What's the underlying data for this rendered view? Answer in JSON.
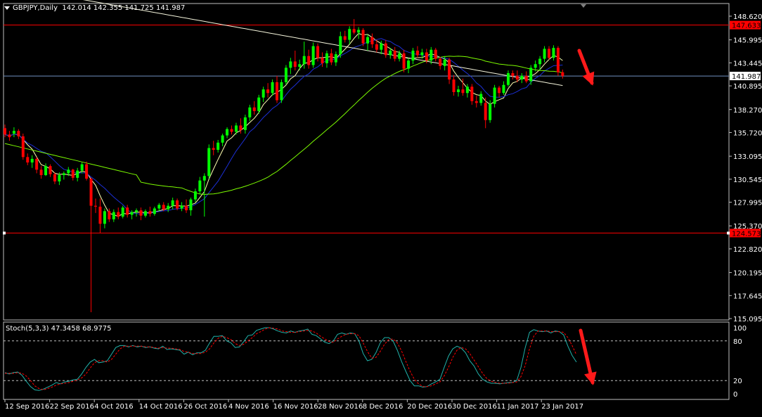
{
  "window": {
    "symbol_label": "GBPJPY,Daily",
    "ohlc_label": "142.014 142.355 141.725 141.987",
    "stoch_label": "Stoch(5,3,3) 47.3458 68.9775"
  },
  "colors": {
    "background": "#000000",
    "grid_border": "#c0c0c0",
    "bull_candle": "#00ff00",
    "bear_candle": "#ff0000",
    "ma_fast": "#ffffb0",
    "ma_mid": "#1c2fd6",
    "ma_slow": "#7cfc00",
    "ma_long": "#f5f5dc",
    "hline": "#ff0000",
    "bid_line": "#6f8fbf",
    "stoch_main": "#20b2aa",
    "stoch_signal": "#ff0000",
    "arrow": "#ff1a1a"
  },
  "chart_data": [
    {
      "type": "candlestick",
      "name": "price",
      "y_ticks": [
        "148.620",
        "145.995",
        "143.445",
        "140.895",
        "138.270",
        "135.720",
        "133.095",
        "130.545",
        "127.995",
        "125.370",
        "122.820",
        "120.195",
        "117.645",
        "115.095"
      ],
      "ylim": [
        115.095,
        148.62
      ],
      "x_ticks": [
        "12 Sep 2016",
        "22 Sep 2016",
        "4 Oct 2016",
        "14 Oct 2016",
        "26 Oct 2016",
        "4 Nov 2016",
        "16 Nov 2016",
        "28 Nov 2016",
        "8 Dec 2016",
        "20 Dec 2016",
        "30 Dec 2016",
        "11 Jan 2017",
        "23 Jan 2017"
      ],
      "price_tags": {
        "upper_level": "147.633",
        "bid": "141.987",
        "lower_level": "124.573"
      },
      "hlines": [
        147.633,
        124.573
      ],
      "bid": 141.987,
      "candles": [
        [
          136.2,
          136.6,
          135.2,
          135.5
        ],
        [
          135.5,
          135.9,
          134.8,
          135.2
        ],
        [
          135.6,
          136.3,
          135.2,
          135.9
        ],
        [
          135.9,
          136.1,
          135.0,
          135.3
        ],
        [
          135.3,
          135.6,
          132.7,
          133.0
        ],
        [
          133.0,
          133.4,
          132.1,
          132.4
        ],
        [
          132.4,
          133.2,
          131.8,
          132.8
        ],
        [
          132.8,
          133.0,
          131.2,
          131.6
        ],
        [
          131.6,
          132.0,
          130.6,
          131.0
        ],
        [
          131.0,
          132.3,
          130.9,
          132.0
        ],
        [
          132.0,
          132.2,
          130.8,
          131.1
        ],
        [
          131.1,
          131.3,
          130.0,
          130.3
        ],
        [
          130.3,
          131.3,
          129.9,
          131.0
        ],
        [
          131.0,
          131.4,
          130.5,
          131.2
        ],
        [
          131.2,
          131.9,
          130.9,
          131.6
        ],
        [
          131.6,
          131.7,
          130.4,
          130.7
        ],
        [
          130.7,
          131.8,
          130.3,
          131.5
        ],
        [
          131.5,
          132.4,
          131.2,
          132.2
        ],
        [
          132.2,
          132.5,
          130.4,
          130.6
        ],
        [
          130.6,
          130.7,
          115.8,
          127.6
        ],
        [
          127.6,
          128.4,
          126.8,
          127.5
        ],
        [
          127.5,
          128.4,
          124.6,
          125.6
        ],
        [
          125.6,
          127.3,
          125.1,
          127.0
        ],
        [
          127.0,
          127.3,
          125.8,
          126.1
        ],
        [
          126.1,
          127.2,
          125.8,
          126.9
        ],
        [
          126.9,
          127.4,
          126.1,
          126.4
        ],
        [
          126.4,
          127.6,
          126.2,
          127.4
        ],
        [
          127.4,
          127.7,
          126.3,
          126.6
        ],
        [
          126.6,
          127.1,
          126.1,
          126.9
        ],
        [
          126.9,
          127.3,
          126.4,
          127.1
        ],
        [
          127.1,
          127.4,
          126.0,
          126.5
        ],
        [
          126.5,
          127.2,
          126.3,
          127.0
        ],
        [
          127.0,
          127.5,
          126.4,
          126.7
        ],
        [
          126.7,
          127.5,
          126.5,
          127.3
        ],
        [
          127.3,
          127.9,
          127.0,
          127.7
        ],
        [
          127.7,
          128.0,
          127.0,
          127.2
        ],
        [
          127.2,
          127.9,
          126.9,
          127.6
        ],
        [
          127.6,
          128.5,
          127.2,
          128.2
        ],
        [
          128.2,
          128.4,
          127.1,
          127.3
        ],
        [
          127.3,
          128.0,
          127.0,
          127.6
        ],
        [
          127.6,
          128.3,
          126.8,
          127.1
        ],
        [
          127.1,
          128.5,
          126.5,
          128.3
        ],
        [
          128.3,
          129.5,
          128.0,
          129.2
        ],
        [
          129.2,
          130.8,
          128.9,
          130.4
        ],
        [
          130.4,
          131.2,
          126.4,
          130.9
        ],
        [
          130.9,
          134.4,
          130.6,
          134.0
        ],
        [
          134.0,
          134.8,
          133.2,
          133.8
        ],
        [
          133.8,
          134.9,
          133.5,
          134.6
        ],
        [
          134.6,
          135.6,
          134.2,
          135.4
        ],
        [
          135.4,
          136.3,
          135.1,
          136.1
        ],
        [
          136.1,
          136.5,
          135.5,
          135.8
        ],
        [
          135.8,
          136.8,
          135.5,
          136.5
        ],
        [
          136.5,
          137.3,
          135.6,
          136.0
        ],
        [
          136.0,
          137.7,
          135.6,
          137.4
        ],
        [
          137.4,
          138.8,
          137.0,
          138.5
        ],
        [
          138.5,
          139.2,
          137.7,
          138.1
        ],
        [
          138.1,
          139.9,
          137.8,
          139.6
        ],
        [
          139.6,
          140.8,
          139.1,
          140.5
        ],
        [
          140.5,
          141.2,
          139.6,
          140.1
        ],
        [
          140.1,
          141.6,
          139.8,
          141.3
        ],
        [
          141.3,
          142.0,
          139.0,
          139.3
        ],
        [
          139.3,
          141.6,
          139.0,
          141.3
        ],
        [
          141.3,
          143.2,
          141.0,
          142.9
        ],
        [
          142.9,
          144.0,
          142.2,
          143.6
        ],
        [
          143.6,
          144.8,
          142.6,
          143.0
        ],
        [
          143.0,
          143.8,
          142.6,
          143.3
        ],
        [
          143.3,
          145.8,
          142.8,
          144.2
        ],
        [
          144.2,
          144.9,
          142.8,
          143.2
        ],
        [
          143.2,
          145.7,
          142.9,
          145.3
        ],
        [
          145.3,
          145.6,
          143.6,
          144.0
        ],
        [
          144.0,
          144.6,
          143.0,
          143.4
        ],
        [
          143.4,
          144.8,
          142.9,
          144.5
        ],
        [
          144.5,
          145.0,
          143.2,
          143.5
        ],
        [
          143.5,
          144.7,
          143.1,
          144.4
        ],
        [
          144.4,
          146.9,
          144.0,
          146.4
        ],
        [
          146.4,
          147.0,
          145.7,
          146.0
        ],
        [
          146.0,
          147.5,
          145.5,
          147.2
        ],
        [
          147.2,
          148.3,
          146.6,
          146.8
        ],
        [
          146.8,
          147.4,
          146.1,
          147.1
        ],
        [
          147.1,
          147.3,
          145.3,
          145.6
        ],
        [
          145.6,
          146.6,
          144.8,
          146.3
        ],
        [
          146.3,
          146.7,
          145.1,
          145.5
        ],
        [
          145.5,
          146.0,
          144.6,
          144.9
        ],
        [
          144.9,
          145.9,
          144.4,
          145.6
        ],
        [
          145.6,
          146.0,
          144.0,
          144.3
        ],
        [
          144.3,
          145.1,
          143.9,
          144.8
        ],
        [
          144.8,
          145.2,
          143.6,
          143.9
        ],
        [
          143.9,
          144.8,
          143.6,
          144.5
        ],
        [
          144.5,
          144.9,
          142.4,
          142.8
        ],
        [
          142.8,
          144.0,
          142.3,
          143.7
        ],
        [
          143.7,
          145.1,
          143.3,
          144.8
        ],
        [
          144.8,
          145.3,
          144.0,
          144.3
        ],
        [
          144.3,
          145.0,
          143.9,
          144.6
        ],
        [
          144.6,
          145.0,
          143.4,
          143.7
        ],
        [
          143.7,
          145.2,
          143.3,
          144.9
        ],
        [
          144.9,
          145.1,
          143.6,
          143.9
        ],
        [
          143.9,
          144.1,
          142.7,
          143.1
        ],
        [
          143.1,
          144.2,
          142.6,
          143.8
        ],
        [
          143.8,
          144.0,
          141.1,
          141.6
        ],
        [
          141.6,
          142.1,
          139.8,
          140.2
        ],
        [
          140.2,
          140.9,
          139.7,
          140.5
        ],
        [
          140.5,
          141.7,
          139.8,
          140.1
        ],
        [
          140.1,
          141.1,
          139.6,
          140.8
        ],
        [
          140.8,
          141.1,
          138.8,
          139.2
        ],
        [
          139.2,
          139.8,
          138.5,
          139.0
        ],
        [
          139.0,
          140.3,
          138.7,
          140.0
        ],
        [
          139.0,
          139.6,
          136.2,
          137.1
        ],
        [
          137.1,
          139.3,
          136.8,
          138.9
        ],
        [
          138.9,
          141.0,
          138.5,
          140.7
        ],
        [
          140.7,
          140.9,
          139.6,
          140.1
        ],
        [
          140.1,
          141.4,
          139.9,
          141.0
        ],
        [
          141.0,
          142.6,
          140.8,
          142.3
        ],
        [
          142.3,
          142.6,
          141.6,
          142.0
        ],
        [
          142.0,
          142.6,
          141.3,
          141.6
        ],
        [
          141.6,
          142.3,
          141.2,
          142.0
        ],
        [
          142.0,
          142.5,
          141.2,
          141.4
        ],
        [
          141.4,
          143.2,
          141.0,
          142.9
        ],
        [
          142.9,
          143.7,
          142.5,
          143.3
        ],
        [
          143.3,
          144.2,
          142.6,
          143.9
        ],
        [
          143.9,
          145.3,
          143.5,
          145.0
        ],
        [
          145.0,
          145.3,
          143.8,
          144.0
        ],
        [
          144.0,
          145.4,
          143.7,
          145.1
        ],
        [
          145.1,
          145.3,
          142.0,
          142.4
        ],
        [
          142.4,
          142.7,
          141.7,
          142.0
        ]
      ]
    },
    {
      "type": "line",
      "name": "stochastic",
      "title": "Stoch(5,3,3) 47.3458 68.9775",
      "y_ticks": [
        "100",
        "80",
        "20",
        "0"
      ],
      "ylim": [
        0,
        100
      ],
      "levels": [
        80,
        20
      ],
      "main": [
        32,
        30,
        32,
        33,
        28,
        19,
        11,
        6,
        5,
        7,
        10,
        13,
        17,
        15,
        18,
        19,
        21,
        22,
        30,
        40,
        48,
        52,
        47,
        48,
        50,
        60,
        70,
        73,
        73,
        71,
        73,
        71,
        72,
        70,
        71,
        69,
        68,
        72,
        67,
        68,
        67,
        66,
        60,
        63,
        59,
        62,
        62,
        66,
        77,
        87,
        87,
        88,
        80,
        77,
        70,
        71,
        79,
        88,
        89,
        96,
        98,
        101,
        100,
        98,
        95,
        93,
        92,
        95,
        93,
        95,
        96,
        98,
        90,
        88,
        83,
        78,
        76,
        80,
        90,
        92,
        90,
        92,
        91,
        80,
        61,
        50,
        52,
        62,
        77,
        85,
        85,
        80,
        66,
        49,
        34,
        20,
        12,
        12,
        10,
        11,
        15,
        18,
        22,
        40,
        57,
        68,
        72,
        69,
        62,
        50,
        42,
        30,
        22,
        18,
        16,
        16,
        15,
        16,
        17,
        17,
        20,
        40,
        70,
        93,
        97,
        95,
        94,
        95,
        92,
        95,
        94,
        89,
        72,
        58,
        48
      ],
      "signal": [
        31,
        31,
        31,
        32,
        31,
        27,
        20,
        12,
        8,
        6,
        8,
        10,
        13,
        15,
        16,
        17,
        19,
        21,
        24,
        30,
        39,
        47,
        50,
        50,
        48,
        52,
        60,
        68,
        72,
        72,
        72,
        72,
        72,
        71,
        71,
        70,
        69,
        70,
        69,
        69,
        68,
        67,
        64,
        63,
        61,
        61,
        61,
        63,
        68,
        77,
        84,
        87,
        85,
        82,
        76,
        73,
        75,
        80,
        85,
        91,
        94,
        98,
        100,
        99,
        98,
        95,
        94,
        93,
        93,
        94,
        95,
        96,
        95,
        92,
        87,
        83,
        79,
        78,
        83,
        87,
        90,
        91,
        91,
        88,
        77,
        64,
        54,
        55,
        64,
        75,
        82,
        83,
        77,
        65,
        49,
        34,
        22,
        15,
        11,
        11,
        12,
        15,
        18,
        27,
        40,
        55,
        66,
        70,
        68,
        61,
        51,
        41,
        31,
        23,
        19,
        17,
        16,
        16,
        16,
        17,
        18,
        26,
        43,
        68,
        87,
        95,
        95,
        95,
        94,
        94,
        94,
        93,
        85,
        73,
        59
      ]
    }
  ]
}
